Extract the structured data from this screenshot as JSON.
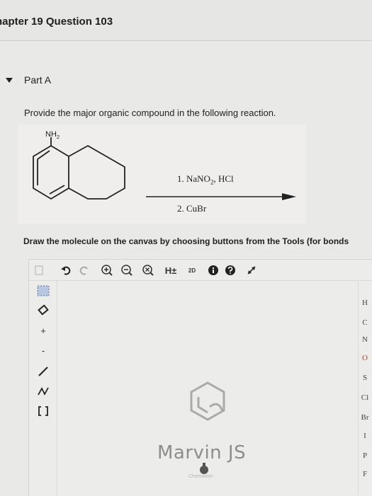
{
  "header": {
    "title": "hapter 19 Question 103"
  },
  "part": {
    "label": "Part A"
  },
  "question": {
    "prompt": "Provide the major organic compound in the following reaction."
  },
  "reaction": {
    "substituent": "NH2",
    "step1": "1. NaNO2, HCl",
    "step2": "2. CuBr"
  },
  "instructions": "Draw the molecule on the canvas by choosing buttons from the Tools (for bonds",
  "editor": {
    "toolbar": [
      "new-doc-icon",
      "undo-icon",
      "redo-icon",
      "zoom-in-icon",
      "zoom-out-icon",
      "zoom-reset-icon",
      "H±",
      "2D",
      "info-icon",
      "help-icon",
      "expand-icon"
    ],
    "h_toggle_label": "H±",
    "clean2d_label": "2D",
    "elements": [
      "H",
      "C",
      "N",
      "O",
      "S",
      "Cl",
      "Br",
      "I",
      "P",
      "F"
    ],
    "brand": "Marvin JS",
    "vendor": "ChemAxon"
  }
}
